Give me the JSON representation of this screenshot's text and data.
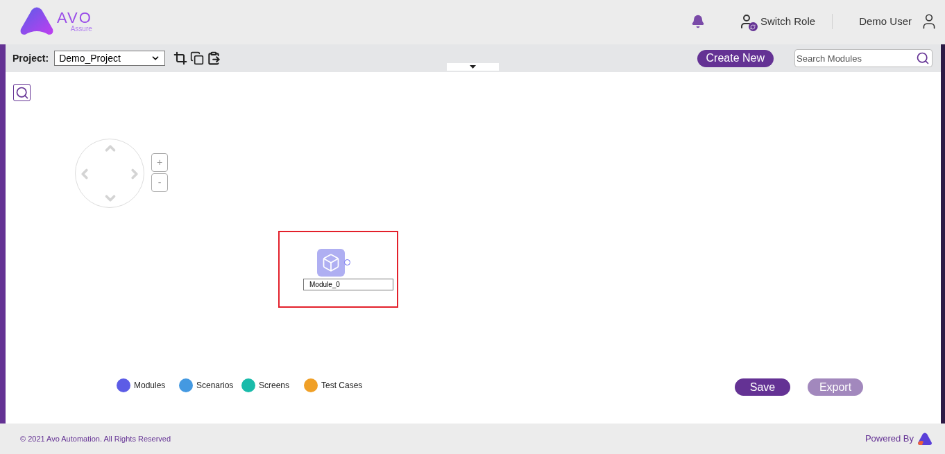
{
  "header": {
    "logo_text": "AVO",
    "logo_subtext": "Assure",
    "switch_role": "Switch Role",
    "user_name": "Demo User"
  },
  "toolbar": {
    "project_label": "Project:",
    "project_value": "Demo_Project",
    "create_button": "Create New",
    "search": {
      "placeholder": "Search Modules"
    }
  },
  "canvas": {
    "zoom_in": "+",
    "zoom_out": "-",
    "node": {
      "kind": "module",
      "value": "Module_0",
      "editing": true
    },
    "legend": [
      {
        "label": "Modules",
        "color": "#5c5ce6"
      },
      {
        "label": "Scenarios",
        "color": "#4499e1"
      },
      {
        "label": "Screens",
        "color": "#19bbaa"
      },
      {
        "label": "Test Cases",
        "color": "#f0a027"
      }
    ],
    "buttons": [
      {
        "label": "Save",
        "disabled": false
      },
      {
        "label": "Export",
        "disabled": true
      }
    ]
  },
  "footer": {
    "copyright": "© 2021 Avo Automation. All Rights Reserved",
    "powered_by": "Powered By"
  }
}
